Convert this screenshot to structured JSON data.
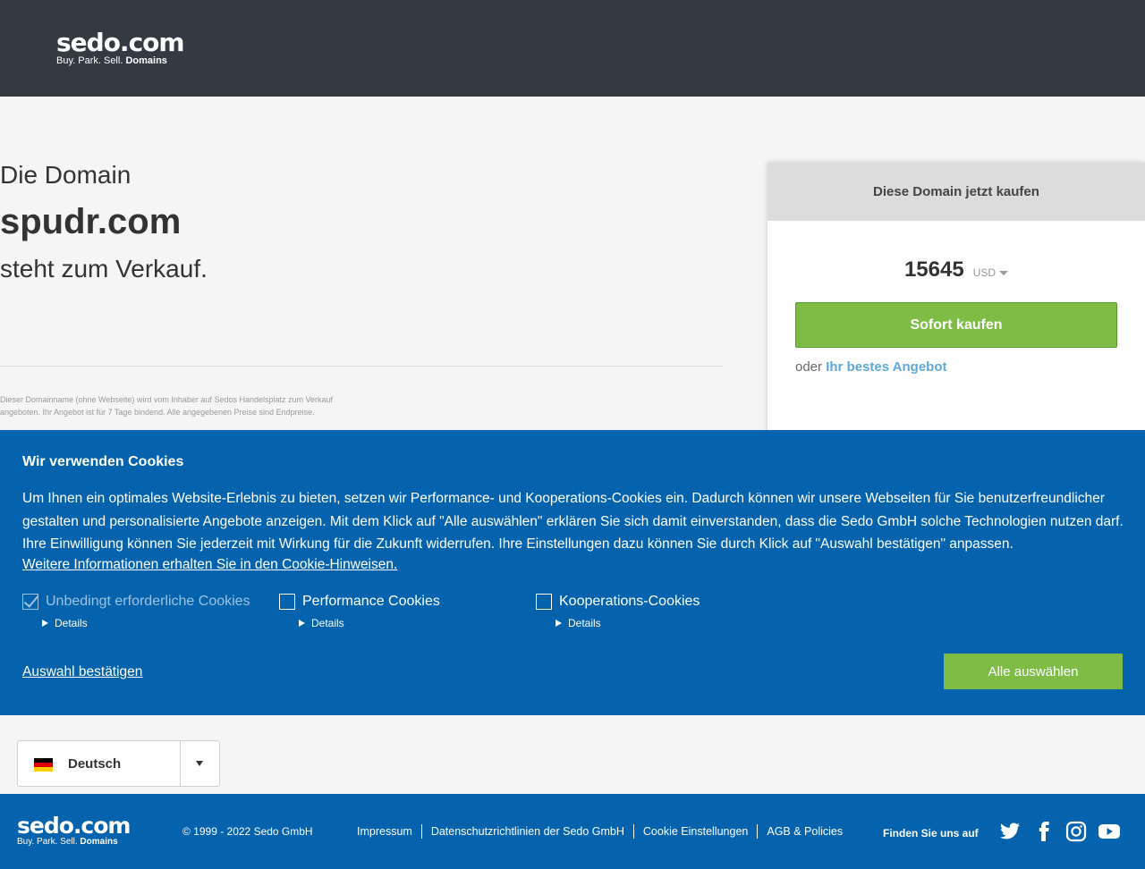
{
  "header": {
    "logo_main": "sedo.com",
    "logo_sub_1": "Buy.  Park.  Sell.",
    "logo_sub_2": "Domains"
  },
  "domain": {
    "intro": "Die Domain",
    "name": "spudr.com",
    "status": "steht zum Verkauf.",
    "disclaimer": "Dieser Domainname (ohne Webseite) wird vom Inhaber auf Sedos Handelsplatz zum Verkauf angeboten. Ihr Angebot ist für 7 Tage bindend. Alle angegebenen Preise sind Endpreise."
  },
  "buybox": {
    "title": "Diese Domain jetzt kaufen",
    "price": "15645",
    "currency": "USD",
    "buy_label": "Sofort kaufen",
    "or_label": "oder",
    "offer_label": "Ihr bestes Angebot"
  },
  "cookie": {
    "title": "Wir verwenden Cookies",
    "text": "Um Ihnen ein optimales Website-Erlebnis zu bieten, setzen wir Performance- und Kooperations-Cookies ein. Dadurch können wir unsere Webseiten für Sie benutzerfreundlicher gestalten und personalisierte Angebote anzeigen. Mit dem Klick auf \"Alle auswählen\" erklären Sie sich damit einverstanden, dass die Sedo GmbH solche Technologien nutzen darf. Ihre Einwilligung können Sie jederzeit mit Wirkung für die Zukunft widerrufen. Ihre Einstellungen dazu können Sie durch Klick auf \"Auswahl bestätigen\" anpassen.",
    "more_link": "Weitere Informationen erhalten Sie in den Cookie-Hinweisen.",
    "options": [
      {
        "label": "Unbedingt erforderliche Cookies",
        "checked": true,
        "details": "Details"
      },
      {
        "label": "Performance Cookies",
        "checked": false,
        "details": "Details"
      },
      {
        "label": "Kooperations-Cookies",
        "checked": false,
        "details": "Details"
      }
    ],
    "confirm_label": "Auswahl bestätigen",
    "select_all_label": "Alle auswählen"
  },
  "language": {
    "selected": "Deutsch"
  },
  "footer": {
    "logo_main": "sedo.com",
    "logo_sub_1": "Buy.  Park.  Sell.",
    "logo_sub_2": "Domains",
    "copyright": "© 1999 - 2022 Sedo GmbH",
    "links": [
      "Impressum",
      "Datenschutzrichtlinien der Sedo GmbH",
      "Cookie Einstellungen",
      "AGB & Policies"
    ],
    "follow_label": "Finden Sie uns auf",
    "social": [
      "twitter-icon",
      "facebook-icon",
      "instagram-icon",
      "youtube-icon"
    ]
  },
  "colors": {
    "header_bg": "#343a42",
    "brand_blue": "#0463ac",
    "accent_green": "#7fbc46",
    "link_blue": "#5fa8d8"
  }
}
